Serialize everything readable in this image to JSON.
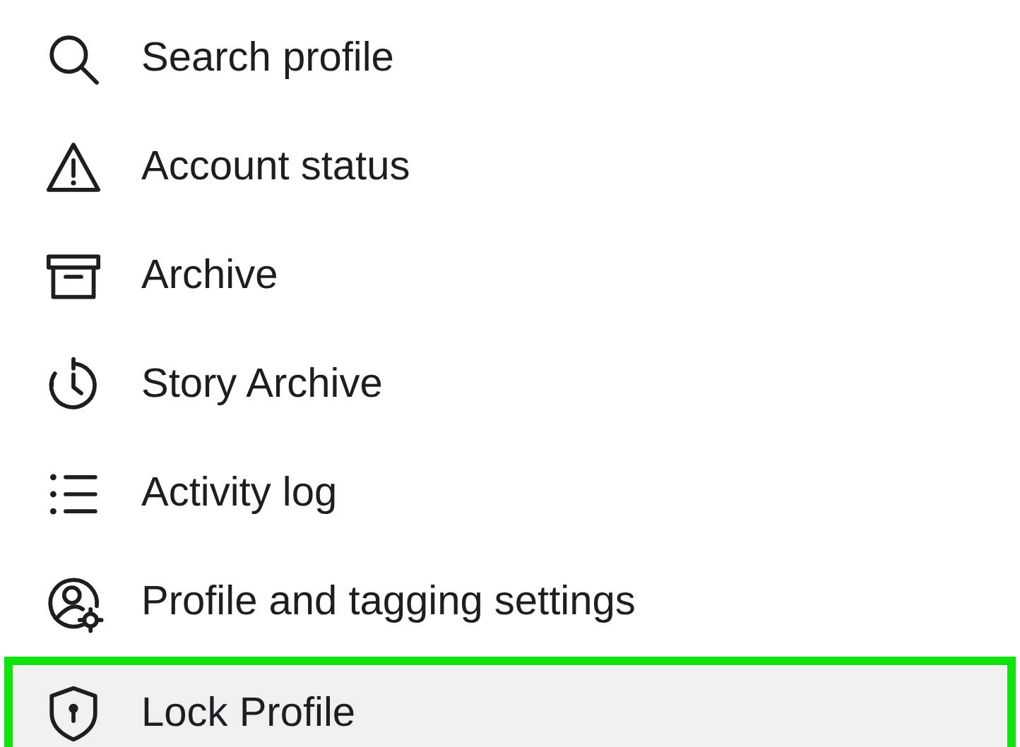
{
  "menu": {
    "items": [
      {
        "label": "Search profile",
        "selected": false
      },
      {
        "label": "Account status",
        "selected": false
      },
      {
        "label": "Archive",
        "selected": false
      },
      {
        "label": "Story Archive",
        "selected": false
      },
      {
        "label": "Activity log",
        "selected": false
      },
      {
        "label": "Profile and tagging settings",
        "selected": false
      },
      {
        "label": "Lock Profile",
        "selected": true
      }
    ]
  }
}
